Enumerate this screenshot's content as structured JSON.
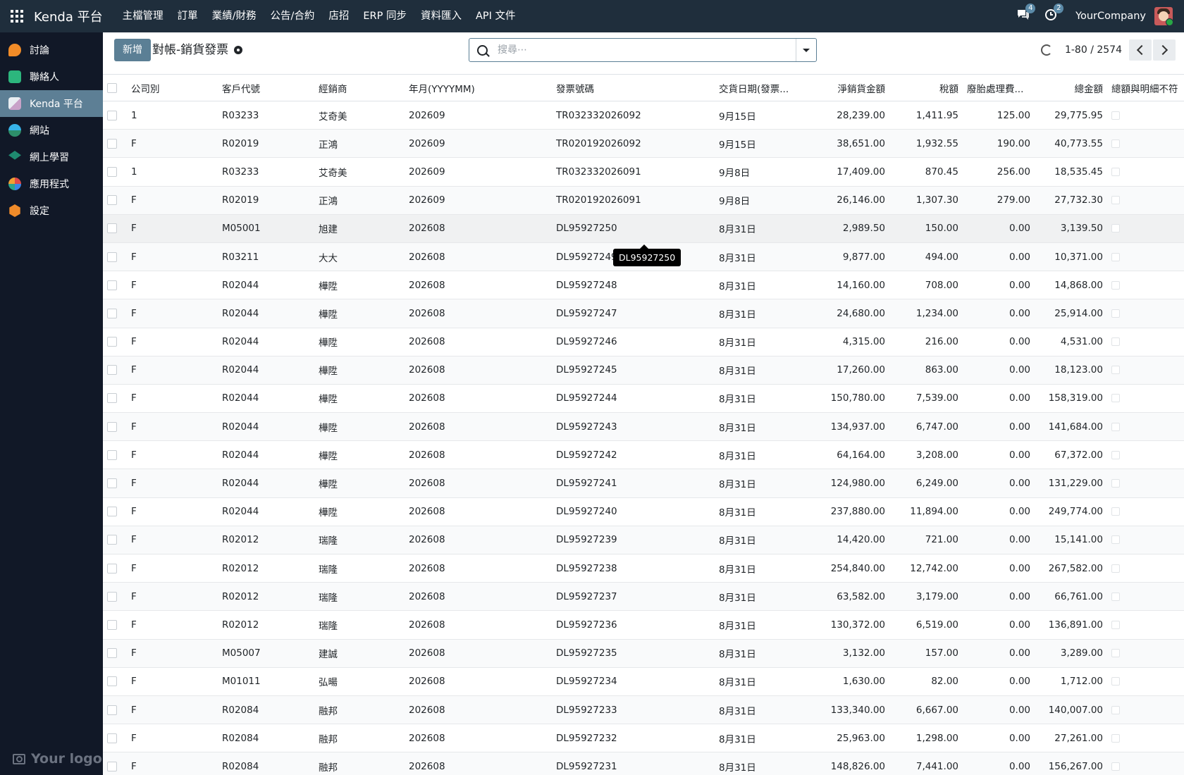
{
  "app": {
    "brand": "Kenda 平台",
    "menu": [
      "主檔管理",
      "訂單",
      "業績/財務",
      "公告/合約",
      "店招",
      "ERP 同步",
      "資料匯入",
      "API 文件"
    ],
    "messages_count": "4",
    "activities_count": "2",
    "company": "YourCompany"
  },
  "sidebar": {
    "items": [
      {
        "label": "討論",
        "icon": "discuss-icon"
      },
      {
        "label": "聯絡人",
        "icon": "contacts-icon"
      },
      {
        "label": "Kenda 平台",
        "icon": "kenda-icon",
        "active": true
      },
      {
        "label": "網站",
        "icon": "website-icon"
      },
      {
        "label": "網上學習",
        "icon": "elearning-icon"
      },
      {
        "label": "應用程式",
        "icon": "apps-icon"
      },
      {
        "label": "設定",
        "icon": "settings-icon"
      }
    ],
    "logo_text": "Your logo"
  },
  "control": {
    "new_button": "新增",
    "title": "對帳-銷貨發票",
    "search_placeholder": "搜尋⋯",
    "pager_value": "1-80 / 2574"
  },
  "table": {
    "columns": [
      "公司別",
      "客戶代號",
      "經銷商",
      "年月(YYYYMM)",
      "發票號碼",
      "交貨日期(發票...",
      "淨銷貨金額",
      "稅額",
      "廢胎處理費...",
      "總金額",
      "總額與明細不符"
    ],
    "rows": [
      [
        "1",
        "R03233",
        "艾奇美",
        "202609",
        "TR032332026092",
        "9月15日",
        "28,239.00",
        "1,411.95",
        "125.00",
        "29,775.95"
      ],
      [
        "F",
        "R02019",
        "正鴻",
        "202609",
        "TR020192026092",
        "9月15日",
        "38,651.00",
        "1,932.55",
        "190.00",
        "40,773.55"
      ],
      [
        "1",
        "R03233",
        "艾奇美",
        "202609",
        "TR032332026091",
        "9月8日",
        "17,409.00",
        "870.45",
        "256.00",
        "18,535.45"
      ],
      [
        "F",
        "R02019",
        "正鴻",
        "202609",
        "TR020192026091",
        "9月8日",
        "26,146.00",
        "1,307.30",
        "279.00",
        "27,732.30"
      ],
      [
        "F",
        "M05001",
        "旭建",
        "202608",
        "DL95927250",
        "8月31日",
        "2,989.50",
        "150.00",
        "0.00",
        "3,139.50"
      ],
      [
        "F",
        "R03211",
        "大大",
        "202608",
        "DL95927249",
        "8月31日",
        "9,877.00",
        "494.00",
        "0.00",
        "10,371.00"
      ],
      [
        "F",
        "R02044",
        "樺陞",
        "202608",
        "DL95927248",
        "8月31日",
        "14,160.00",
        "708.00",
        "0.00",
        "14,868.00"
      ],
      [
        "F",
        "R02044",
        "樺陞",
        "202608",
        "DL95927247",
        "8月31日",
        "24,680.00",
        "1,234.00",
        "0.00",
        "25,914.00"
      ],
      [
        "F",
        "R02044",
        "樺陞",
        "202608",
        "DL95927246",
        "8月31日",
        "4,315.00",
        "216.00",
        "0.00",
        "4,531.00"
      ],
      [
        "F",
        "R02044",
        "樺陞",
        "202608",
        "DL95927245",
        "8月31日",
        "17,260.00",
        "863.00",
        "0.00",
        "18,123.00"
      ],
      [
        "F",
        "R02044",
        "樺陞",
        "202608",
        "DL95927244",
        "8月31日",
        "150,780.00",
        "7,539.00",
        "0.00",
        "158,319.00"
      ],
      [
        "F",
        "R02044",
        "樺陞",
        "202608",
        "DL95927243",
        "8月31日",
        "134,937.00",
        "6,747.00",
        "0.00",
        "141,684.00"
      ],
      [
        "F",
        "R02044",
        "樺陞",
        "202608",
        "DL95927242",
        "8月31日",
        "64,164.00",
        "3,208.00",
        "0.00",
        "67,372.00"
      ],
      [
        "F",
        "R02044",
        "樺陞",
        "202608",
        "DL95927241",
        "8月31日",
        "124,980.00",
        "6,249.00",
        "0.00",
        "131,229.00"
      ],
      [
        "F",
        "R02044",
        "樺陞",
        "202608",
        "DL95927240",
        "8月31日",
        "237,880.00",
        "11,894.00",
        "0.00",
        "249,774.00"
      ],
      [
        "F",
        "R02012",
        "瑞隆",
        "202608",
        "DL95927239",
        "8月31日",
        "14,420.00",
        "721.00",
        "0.00",
        "15,141.00"
      ],
      [
        "F",
        "R02012",
        "瑞隆",
        "202608",
        "DL95927238",
        "8月31日",
        "254,840.00",
        "12,742.00",
        "0.00",
        "267,582.00"
      ],
      [
        "F",
        "R02012",
        "瑞隆",
        "202608",
        "DL95927237",
        "8月31日",
        "63,582.00",
        "3,179.00",
        "0.00",
        "66,761.00"
      ],
      [
        "F",
        "R02012",
        "瑞隆",
        "202608",
        "DL95927236",
        "8月31日",
        "130,372.00",
        "6,519.00",
        "0.00",
        "136,891.00"
      ],
      [
        "F",
        "M05007",
        "建誠",
        "202608",
        "DL95927235",
        "8月31日",
        "3,132.00",
        "157.00",
        "0.00",
        "3,289.00"
      ],
      [
        "F",
        "M01011",
        "弘暘",
        "202608",
        "DL95927234",
        "8月31日",
        "1,630.00",
        "82.00",
        "0.00",
        "1,712.00"
      ],
      [
        "F",
        "R02084",
        "融邦",
        "202608",
        "DL95927233",
        "8月31日",
        "133,340.00",
        "6,667.00",
        "0.00",
        "140,007.00"
      ],
      [
        "F",
        "R02084",
        "融邦",
        "202608",
        "DL95927232",
        "8月31日",
        "25,963.00",
        "1,298.00",
        "0.00",
        "27,261.00"
      ],
      [
        "F",
        "R02084",
        "融邦",
        "202608",
        "DL95927231",
        "8月31日",
        "148,826.00",
        "7,441.00",
        "0.00",
        "156,267.00"
      ]
    ]
  },
  "tooltip": "DL95927250"
}
